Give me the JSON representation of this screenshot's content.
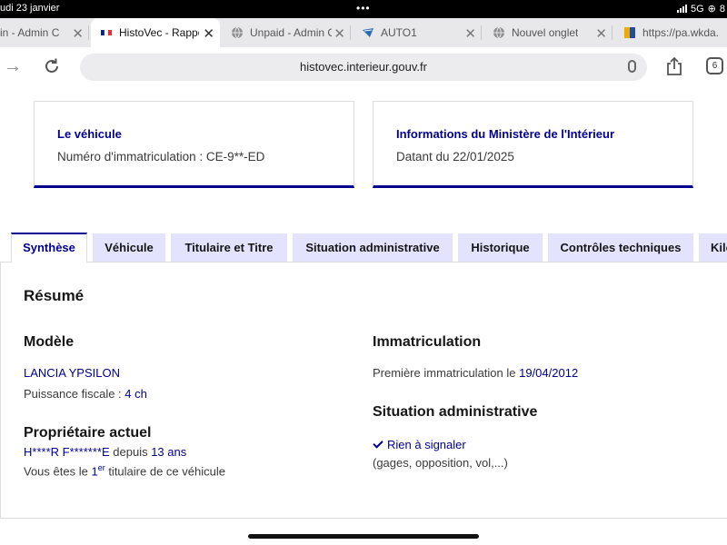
{
  "status_bar": {
    "date": "udi 23 janvier",
    "network": "5G",
    "battery": "8"
  },
  "browser": {
    "tabs": [
      {
        "title": "in - Admin C",
        "active": false
      },
      {
        "title": "HistoVec - Rappo",
        "active": true
      },
      {
        "title": "Unpaid - Admin C",
        "active": false
      },
      {
        "title": "AUTO1",
        "active": false
      },
      {
        "title": "Nouvel onglet",
        "active": false
      },
      {
        "title": "https://pa.wkda.",
        "active": false
      }
    ],
    "url": "histovec.interieur.gouv.fr",
    "tab_count": "6"
  },
  "cards": {
    "vehicle": {
      "title": "Le véhicule",
      "text": "Numéro d'immatriculation : CE-9**-ED"
    },
    "ministry": {
      "title": "Informations du Ministère de l'Intérieur",
      "text": "Datant du 22/01/2025"
    }
  },
  "section_tabs": [
    {
      "label": "Synthèse",
      "active": true
    },
    {
      "label": "Véhicule",
      "active": false
    },
    {
      "label": "Titulaire et Titre",
      "active": false
    },
    {
      "label": "Situation administrative",
      "active": false
    },
    {
      "label": "Historique",
      "active": false
    },
    {
      "label": "Contrôles techniques",
      "active": false
    },
    {
      "label": "Kilo",
      "active": false
    }
  ],
  "summary": {
    "title": "Résumé",
    "model": {
      "heading": "Modèle",
      "name": "LANCIA YPSILON",
      "power_label": "Puissance fiscale : ",
      "power_value": "4 ch"
    },
    "owner": {
      "heading": "Propriétaire actuel",
      "name": "H****R F*******E",
      "since_label": " depuis ",
      "since_value": "13 ans",
      "rank_prefix": "Vous êtes le ",
      "rank_number": "1",
      "rank_sup": "er",
      "rank_suffix": " titulaire de ce véhicule"
    },
    "registration": {
      "heading": "Immatriculation",
      "label": "Première immatriculation le ",
      "date": "19/04/2012"
    },
    "admin_status": {
      "heading": "Situation administrative",
      "status": "Rien à signaler",
      "details": "(gages, opposition, vol,...)"
    }
  },
  "colors": {
    "brand_blue": "#000091",
    "tab_inactive_bg": "#e3e3fd"
  }
}
